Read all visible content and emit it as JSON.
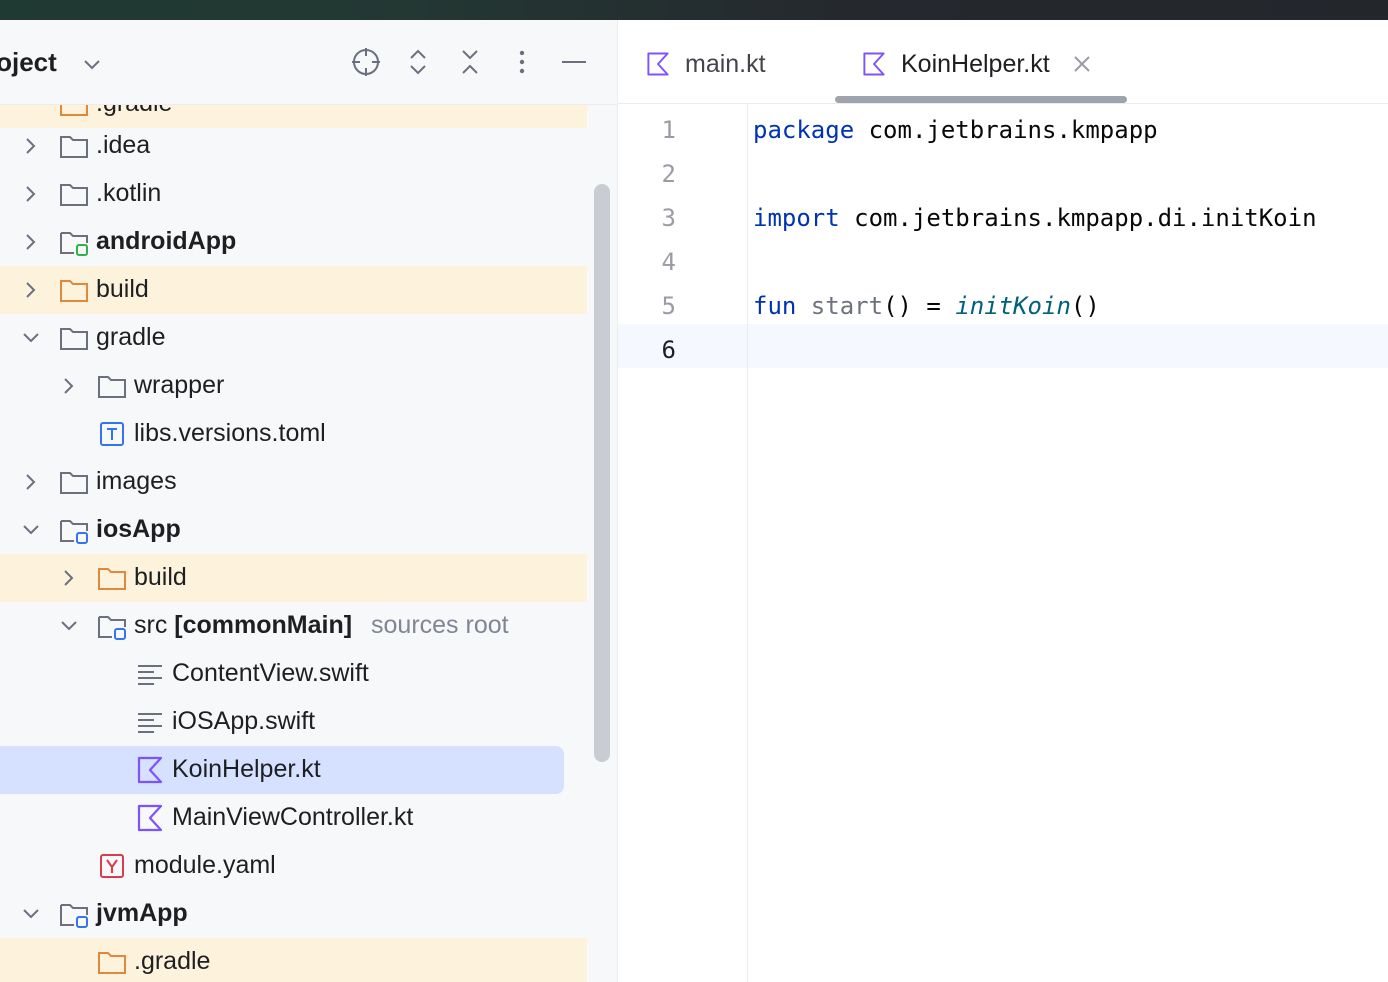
{
  "project": {
    "title": "Project",
    "title_visible": "roject",
    "tree": [
      {
        "label": ".gradle",
        "visible": ".gradle",
        "partial": true
      },
      {
        "label": ".idea"
      },
      {
        "label": ".kotlin"
      },
      {
        "label": "androidApp"
      },
      {
        "label": "build"
      },
      {
        "label": "gradle"
      },
      {
        "label": "wrapper"
      },
      {
        "label": "libs.versions.toml"
      },
      {
        "label": "images"
      },
      {
        "label": "iosApp"
      },
      {
        "label": "build"
      },
      {
        "label": "src",
        "suffix": "[commonMain]",
        "hint": "sources root"
      },
      {
        "label": "ContentView.swift"
      },
      {
        "label": "iOSApp.swift"
      },
      {
        "label": "KoinHelper.kt"
      },
      {
        "label": "MainViewController.kt"
      },
      {
        "label": "module.yaml"
      },
      {
        "label": "jvmApp"
      },
      {
        "label": ".gradle"
      }
    ]
  },
  "editor": {
    "tabs": [
      {
        "label": "main.kt"
      },
      {
        "label": "KoinHelper.kt",
        "active": true
      }
    ],
    "lines": [
      "1",
      "2",
      "3",
      "4",
      "5",
      "6"
    ],
    "code": {
      "l1_kw": "package",
      "l1_rest": " com.jetbrains.kmpapp",
      "l3_kw": "import",
      "l3_rest": " com.jetbrains.kmpapp.di.initKoin",
      "l5_kw": "fun",
      "l5_fn": " start",
      "l5_mid": "() = ",
      "l5_call": "initKoin",
      "l5_end": "()"
    }
  },
  "colors": {
    "excluded_bg": "#fdf3dd",
    "selected_bg": "#d5e1ff",
    "keyword": "#0033b3",
    "kotlin_icon": "#7f52ff"
  }
}
